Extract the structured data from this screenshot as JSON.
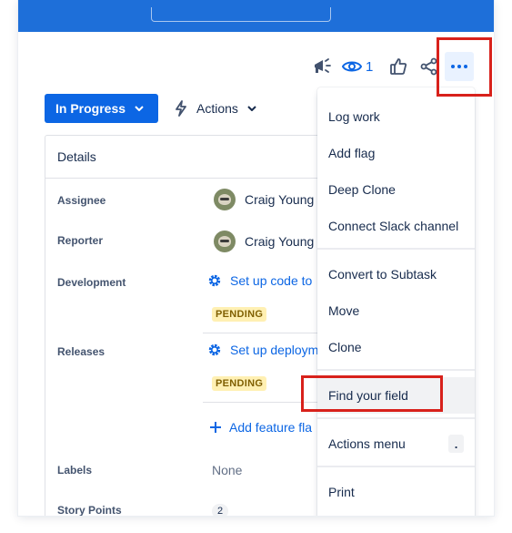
{
  "header": {
    "watch_count": "1"
  },
  "status": {
    "label": "In Progress"
  },
  "actions": {
    "label": "Actions"
  },
  "details": {
    "title": "Details",
    "fields": {
      "assignee": {
        "label": "Assignee",
        "value": "Craig Young"
      },
      "reporter": {
        "label": "Reporter",
        "value": "Craig Young"
      },
      "development": {
        "label": "Development",
        "value": "Set up code to",
        "badge": "PENDING"
      },
      "releases": {
        "label": "Releases",
        "value": "Set up deploym",
        "badge": "PENDING",
        "add": "Add feature fla"
      },
      "labels": {
        "label": "Labels",
        "value": "None"
      },
      "story_points": {
        "label": "Story Points",
        "value": "2"
      }
    }
  },
  "menu": {
    "items": [
      "Log work",
      "Add flag",
      "Deep Clone",
      "Connect Slack channel",
      "Convert to Subtask",
      "Move",
      "Clone",
      "Find your field",
      "Actions menu",
      "Print"
    ],
    "shortcut": "."
  },
  "colors": {
    "primary": "#0c66e4",
    "topbar": "#1e6fd9",
    "annotation": "#d8211b",
    "pending_bg": "#fff0b3"
  },
  "icons": [
    "announcement-icon",
    "eye-icon",
    "thumbs-up-icon",
    "share-icon",
    "more-icon",
    "lightning-icon",
    "chevron-down-icon",
    "gear-icon",
    "plus-icon"
  ]
}
